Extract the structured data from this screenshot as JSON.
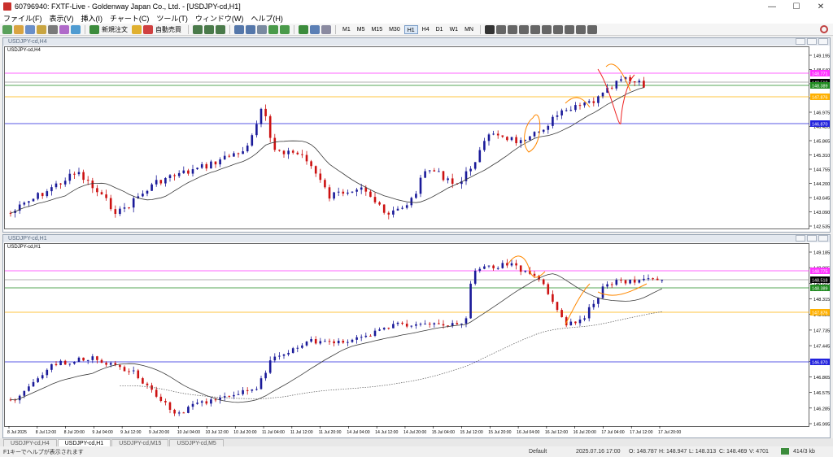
{
  "window": {
    "title": "60796940: FXTF-Live - Goldenway Japan Co., Ltd. - [USDJPY-cd,H1]",
    "controls": [
      "—",
      "☐",
      "✕"
    ]
  },
  "menu": [
    "ファイル(F)",
    "表示(V)",
    "挿入(I)",
    "チャート(C)",
    "ツール(T)",
    "ウィンドウ(W)",
    "ヘルプ(H)"
  ],
  "toolbar": {
    "new_order": "新規注文",
    "auto_trade": "自動売買",
    "timeframes": [
      "M1",
      "M5",
      "M15",
      "M30",
      "H1",
      "H4",
      "D1",
      "W1",
      "MN"
    ],
    "active_timeframe": "H1"
  },
  "chart_h4": {
    "window_title": "USDJPY-cd,H4",
    "symbol_label": "USDJPY-cd,H4",
    "price_ticks": [
      "149.195",
      "148.640",
      "148.085",
      "147.530",
      "146.975",
      "146.420",
      "145.865",
      "145.310",
      "144.755",
      "144.200",
      "143.645",
      "143.090",
      "142.535"
    ],
    "price_boxes": [
      {
        "text": "148.771",
        "color": "#ff33ff"
      },
      {
        "text": "148.518",
        "color": "#000000"
      },
      {
        "text": "148.389",
        "color": "#1f8a1f"
      },
      {
        "text": "147.876",
        "color": "#ffb000"
      },
      {
        "text": "146.870",
        "color": "#2222dd"
      }
    ]
  },
  "chart_h1": {
    "window_title": "USDJPY-cd,H1",
    "symbol_label": "USDJPY-cd,H1",
    "price_ticks": [
      "149.185",
      "148.895",
      "148.605",
      "148.315",
      "148.025",
      "147.735",
      "147.445",
      "147.155",
      "146.865",
      "146.575",
      "146.285",
      "145.995"
    ],
    "price_boxes": [
      {
        "text": "148.775",
        "color": "#ff33ff"
      },
      {
        "text": "148.518",
        "color": "#000000"
      },
      {
        "text": "148.389",
        "color": "#1f8a1f"
      },
      {
        "text": "147.876",
        "color": "#ffb000"
      },
      {
        "text": "146.870",
        "color": "#2222dd"
      }
    ],
    "time_ticks": [
      "8 Jul 2025",
      "8 Jul 12:00",
      "8 Jul 20:00",
      "9 Jul 04:00",
      "9 Jul 12:00",
      "9 Jul 20:00",
      "10 Jul 04:00",
      "10 Jul 12:00",
      "10 Jul 20:00",
      "11 Jul 04:00",
      "11 Jul 12:00",
      "11 Jul 20:00",
      "14 Jul 04:00",
      "14 Jul 12:00",
      "14 Jul 20:00",
      "15 Jul 04:00",
      "15 Jul 12:00",
      "15 Jul 20:00",
      "16 Jul 04:00",
      "16 Jul 12:00",
      "16 Jul 20:00",
      "17 Jul 04:00",
      "17 Jul 12:00",
      "17 Jul 20:00"
    ]
  },
  "tabs": [
    "USDJPY-cd,H4",
    "USDJPY-cd,H1",
    "USDJPY-cd,M15",
    "USDJPY-cd,M5"
  ],
  "active_tab": "USDJPY-cd,H1",
  "status": {
    "help": "F1キーでヘルプが表示されます",
    "profile": "Default",
    "datetime": "2025.07.16 17:00",
    "open": "O: 148.787",
    "high": "H: 148.947",
    "low": "L: 148.313",
    "close": "C: 148.469",
    "volume": "V: 4701",
    "traffic": "414/3 kb"
  },
  "colors": {
    "bull": "#1a1a99",
    "bear": "#cc1111",
    "ma_fast": "#3a3a3a",
    "ma_slow": "#555555",
    "annot": "#ff8800",
    "annot_red": "#ee2222"
  }
}
